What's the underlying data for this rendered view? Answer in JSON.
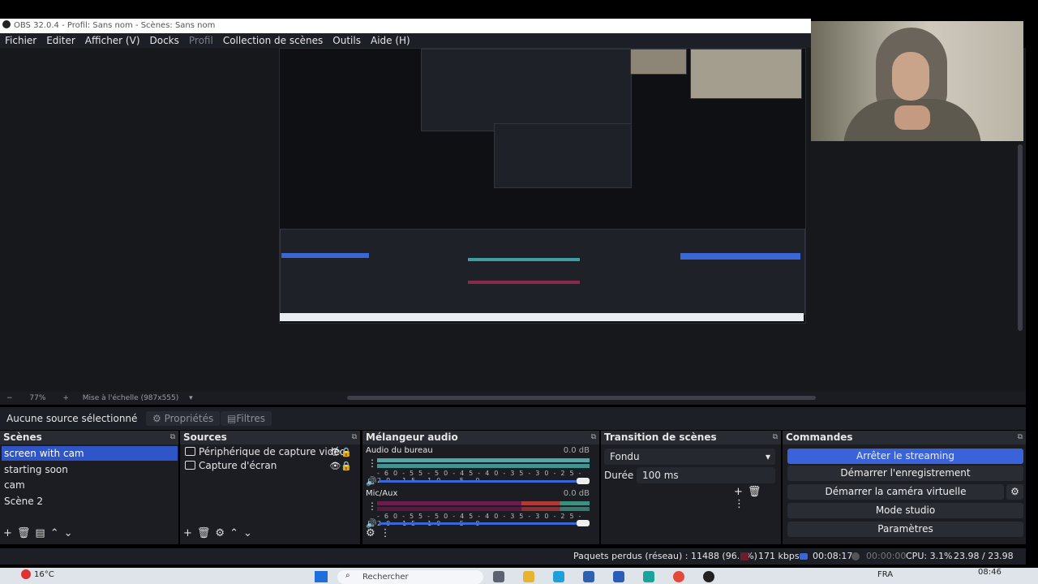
{
  "window": {
    "title": "OBS 32.0.4 - Profil: Sans nom - Scènes: Sans nom"
  },
  "menu": [
    "Fichier",
    "Editer",
    "Afficher (V)",
    "Docks",
    "Profil",
    "Collection de scènes",
    "Outils",
    "Aide (H)"
  ],
  "zoom": {
    "minus": "−",
    "value": "77%",
    "plus": "+",
    "scale_label": "Mise à l'échelle (987x555)"
  },
  "context": {
    "no_source": "Aucune source sélectionné",
    "properties": "Propriétés",
    "filters": "Filtres"
  },
  "scenes": {
    "title": "Scènes",
    "items": [
      "screen with cam",
      "starting soon",
      "cam",
      "Scène 2"
    ],
    "selected_index": 0
  },
  "sources": {
    "title": "Sources",
    "items": [
      "Périphérique de capture vidéo",
      "Capture d'écran"
    ]
  },
  "mixer": {
    "title": "Mélangeur audio",
    "channels": [
      {
        "name": "Audio du bureau",
        "db": "0.0 dB"
      },
      {
        "name": "Mic/Aux",
        "db": "0.0 dB"
      }
    ],
    "scale": [
      "-60",
      "-55",
      "-50",
      "-45",
      "-40",
      "-35",
      "-30",
      "-25",
      "-20",
      "-15",
      "-10",
      "-5",
      "0"
    ]
  },
  "transition": {
    "title": "Transition de scènes",
    "type": "Fondu",
    "duration_label": "Durée",
    "duration_value": "100 ms"
  },
  "controls": {
    "title": "Commandes",
    "stop_streaming": "Arrêter le streaming",
    "start_recording": "Démarrer l'enregistrement",
    "start_virtual_cam": "Démarrer la caméra virtuelle",
    "studio_mode": "Mode studio",
    "settings": "Paramètres"
  },
  "status": {
    "dropped": "Paquets perdus (réseau) : 11488 (96.7%)",
    "bitrate": "171 kbps",
    "stream_time": "00:08:17",
    "rec_time": "00:00:00",
    "cpu": "CPU: 3.1%",
    "fps": "23.98 / 23.98 FPS"
  },
  "taskbar": {
    "weather_temp": "16°C",
    "search_placeholder": "Rechercher",
    "lang": "FRA",
    "time": "08:46"
  },
  "colors": {
    "accent": "#3a63d9",
    "bg": "#1b1d23",
    "panel_header": "#292b33"
  }
}
